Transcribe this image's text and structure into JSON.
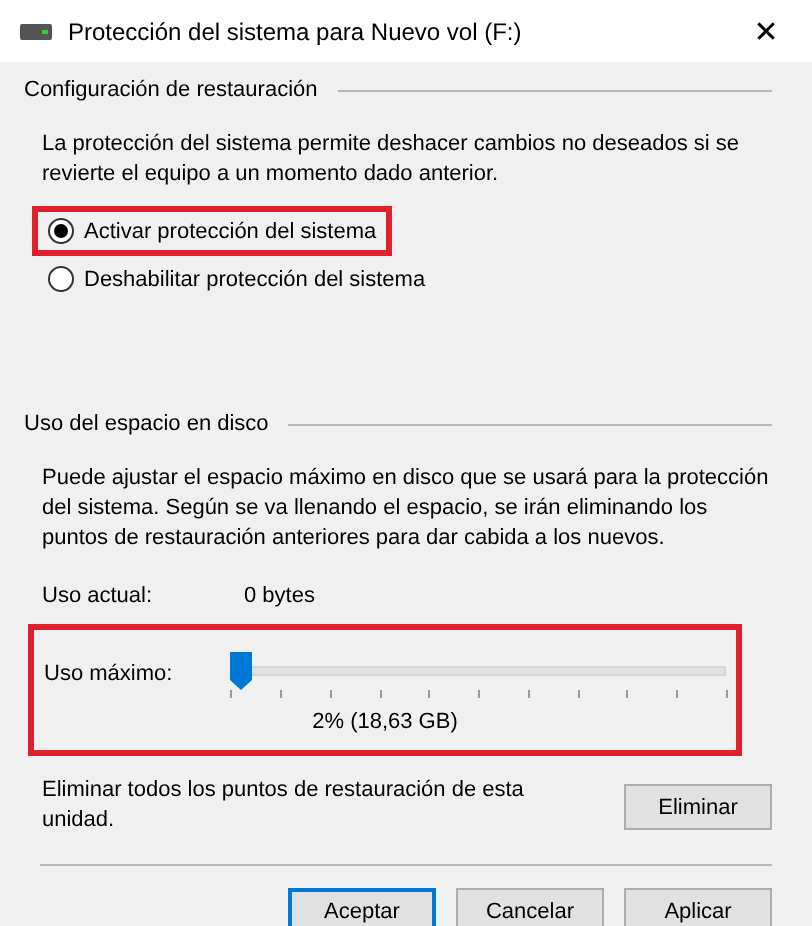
{
  "window": {
    "title": "Protección del sistema para Nuevo vol (F:)",
    "close": "✕"
  },
  "restore_settings": {
    "heading": "Configuración de restauración",
    "description": "La protección del sistema permite deshacer cambios no deseados si se revierte el equipo a un momento dado anterior.",
    "options": [
      {
        "label": "Activar protección del sistema",
        "selected": true,
        "highlighted": true
      },
      {
        "label": "Deshabilitar protección del sistema",
        "selected": false,
        "highlighted": false
      }
    ]
  },
  "disk_usage": {
    "heading": "Uso del espacio en disco",
    "description": "Puede ajustar el espacio máximo en disco que se usará para la protección del sistema. Según se va llenando el espacio, se irán eliminando los puntos de restauración anteriores para dar cabida a los nuevos.",
    "current_label": "Uso actual:",
    "current_value": "0 bytes",
    "max_label": "Uso máximo:",
    "level": 0.02,
    "max_reading": "2% (18,63 GB)",
    "max_highlighted": true,
    "delete_text": "Eliminar todos los puntos de restauración de esta unidad.",
    "delete_button": "Eliminar"
  },
  "buttons": [
    {
      "label": "Aceptar",
      "default": true
    },
    {
      "label": "Cancelar",
      "default": false
    },
    {
      "label": "Aplicar",
      "default": false
    }
  ]
}
